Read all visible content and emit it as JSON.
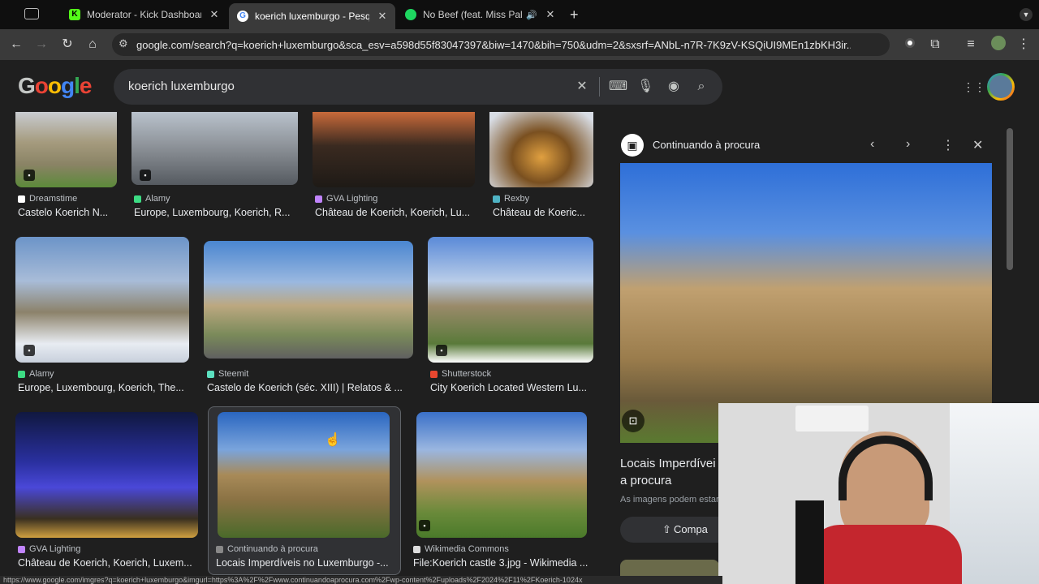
{
  "tabs": [
    {
      "label": "Moderator - Kick Dashboard",
      "favicon": "kick-icon"
    },
    {
      "label": "koerich luxemburgo - Pesquisa",
      "favicon": "google-icon"
    },
    {
      "label": "No Beef (feat. Miss Palmer)",
      "favicon": "spotify-icon"
    }
  ],
  "toolbar": {
    "url": "google.com/search?q=koerich+luxemburgo&sca_esv=a598d55f83047397&biw=1470&bih=750&udm=2&sxsrf=ANbL-n7R-7K9zV-KSQiUI9MEn1zbKH3ir..."
  },
  "search": {
    "logo": "Google",
    "query": "koerich luxemburgo"
  },
  "results": [
    {
      "source": "Dreamstime",
      "title": "Castelo Koerich N...",
      "fav": "#ffffff"
    },
    {
      "source": "Alamy",
      "title": "Europe, Luxembourg, Koerich, R...",
      "fav": "#3ddc84"
    },
    {
      "source": "GVA Lighting",
      "title": "Château de Koerich, Koerich, Lu...",
      "fav": "#c084fc"
    },
    {
      "source": "Rexby",
      "title": "Château de Koeric...",
      "fav": "#4fb3c4"
    },
    {
      "source": "Alamy",
      "title": "Europe, Luxembourg, Koerich, The...",
      "fav": "#3ddc84"
    },
    {
      "source": "Steemit",
      "title": "Castelo de Koerich (séc. XIII) | Relatos & ...",
      "fav": "#5ce0c0"
    },
    {
      "source": "Shutterstock",
      "title": "City Koerich Located Western Lu...",
      "fav": "#e8472f"
    },
    {
      "source": "GVA Lighting",
      "title": "Château de Koerich, Koerich, Luxem...",
      "fav": "#c084fc"
    },
    {
      "source": "Continuando à procura",
      "title": "Locais Imperdíveis no Luxemburgo -...",
      "fav": "#888888"
    },
    {
      "source": "Wikimedia Commons",
      "title": "File:Koerich castle 3.jpg - Wikimedia ...",
      "fav": "#dddddd"
    }
  ],
  "panel": {
    "site": "Continuando à procura",
    "title_line1": "Locais Imperdívei",
    "title_line2": "a procura",
    "note": "As imagens podem estar s",
    "share_label": "Compa"
  },
  "status_url": "https://www.google.com/imgres?q=koerich+luxemburgo&imgurl=https%3A%2F%2Fwww.continuandoaprocura.com%2Fwp-content%2Fuploads%2F2024%2F11%2FKoerich-1024x"
}
